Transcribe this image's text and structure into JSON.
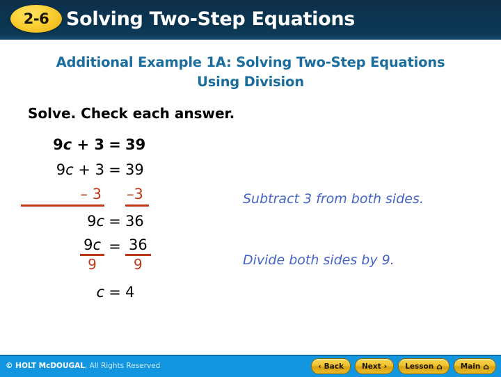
{
  "header": {
    "badge": "2-6",
    "title": "Solving Two-Step Equations",
    "bg_color": "#0c3450",
    "badge_color": "#fcd236"
  },
  "subtitle": {
    "line1": "Additional Example 1A: Solving Two-Step Equations",
    "line2": "Using Division",
    "color": "#1a6d9c"
  },
  "prompt": "Solve. Check each answer.",
  "work": {
    "accent_color": "#c0381a",
    "rows": {
      "original": {
        "lhs": "9c + 3",
        "eq": "=",
        "rhs": "39"
      },
      "copy": {
        "lhs": "9c + 3",
        "eq": "=",
        "rhs": "39"
      },
      "subtract": {
        "lhs": "– 3",
        "rhs": "–3"
      },
      "result": {
        "lhs": "9c",
        "eq": "=",
        "rhs": "36"
      },
      "divide": {
        "lhs_num": "9c",
        "lhs_den": "9",
        "eq": "=",
        "rhs_num": "36",
        "rhs_den": "9"
      },
      "final": {
        "lhs": "c",
        "eq": "=",
        "rhs": "4"
      }
    }
  },
  "notes": {
    "color": "#4464c8",
    "note1": "Subtract 3 from both sides.",
    "note2": "Divide both sides by 9."
  },
  "footer": {
    "bg_color": "#1296e0",
    "copyright_brand": "© HOLT McDOUGAL",
    "copyright_rights": ", All Rights Reserved",
    "buttons": [
      {
        "label": "Back",
        "icon": "chevron-left",
        "glyph": "‹"
      },
      {
        "label": "Next",
        "icon": "chevron-right",
        "glyph": "›"
      },
      {
        "label": "Lesson",
        "icon": "home",
        "glyph": "⌂"
      },
      {
        "label": "Main",
        "icon": "home",
        "glyph": "⌂"
      }
    ]
  }
}
